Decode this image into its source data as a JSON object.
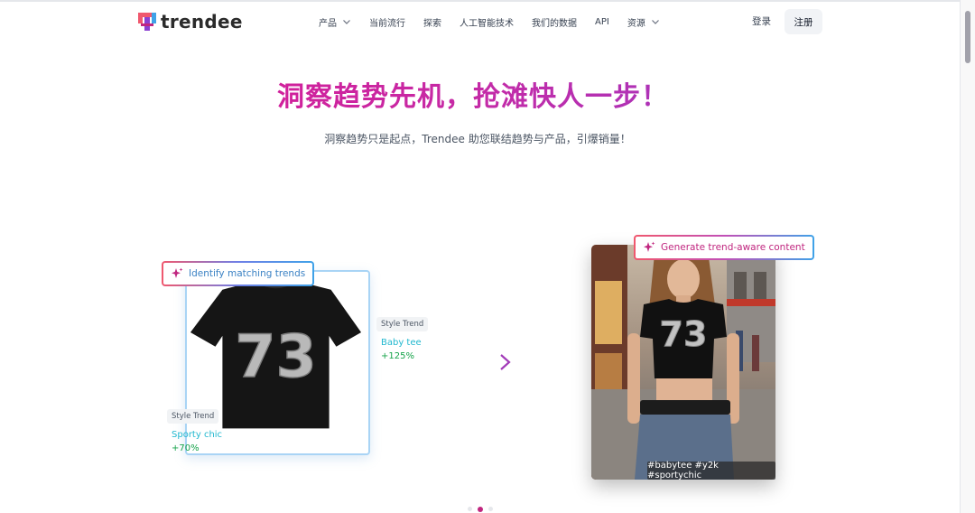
{
  "brand": {
    "name": "trendee",
    "colors": {
      "pink": "#e0138c",
      "purple": "#8a3fd1",
      "blue": "#3fa2e8",
      "red": "#f0586e"
    }
  },
  "nav": {
    "items": [
      {
        "label": "产品",
        "dropdown": true
      },
      {
        "label": "当前流行",
        "dropdown": false
      },
      {
        "label": "探索",
        "dropdown": false
      },
      {
        "label": "人工智能技术",
        "dropdown": false
      },
      {
        "label": "我们的数据",
        "dropdown": false
      },
      {
        "label": "API",
        "dropdown": false
      },
      {
        "label": "资源",
        "dropdown": true
      }
    ],
    "login": "登录",
    "signup": "注册"
  },
  "hero": {
    "title": "洞察趋势先机，抢滩快人一步！",
    "subtitle": "洞察趋势只是起点，Trendee 助您联结趋势与产品，引爆销量！"
  },
  "demo": {
    "left_tag": "Identify matching trends",
    "right_tag": "Generate trend-aware content",
    "product_graphic": "73",
    "trends": [
      {
        "label": "Style Trend",
        "name": "Baby tee",
        "change": "+125%"
      },
      {
        "label": "Style Trend",
        "name": "Sporty chic",
        "change": "+70%"
      }
    ],
    "hashtags": "#babytee #y2k #sportychic"
  },
  "carousel": {
    "count": 3,
    "active": 1
  }
}
